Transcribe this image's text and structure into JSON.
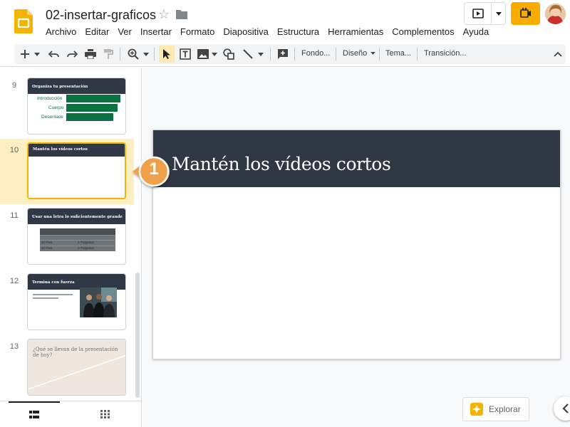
{
  "document": {
    "title": "02-insertar-graficos"
  },
  "menu": [
    "Archivo",
    "Editar",
    "Ver",
    "Insertar",
    "Formato",
    "Diapositiva",
    "Estructura",
    "Herramientas",
    "Complementos",
    "Ayuda"
  ],
  "toolbar": {
    "background": "Fondo...",
    "layout": "Diseño",
    "theme": "Tema...",
    "transition": "Transición..."
  },
  "filmstrip": {
    "slides": [
      {
        "number": "9",
        "title": "Organiza tu presentación",
        "rows": [
          "Introducción",
          "Cuerpo",
          "Desenlace"
        ]
      },
      {
        "number": "10",
        "title": "Mantén los vídeos cortos",
        "selected": true
      },
      {
        "number": "11",
        "title": "Usar una letra lo suficientemente grande",
        "table": [
          [
            "",
            ""
          ],
          [
            "30 Pies",
            "2 Pulgadas"
          ],
          [
            "30 Pies",
            "3 Pulgadas"
          ]
        ]
      },
      {
        "number": "12",
        "title": "Termina con fuerza"
      },
      {
        "number": "13",
        "title": "¿Qué se llevan de la presentación de hoy?"
      }
    ]
  },
  "slide": {
    "title": "Mantén los vídeos cortos"
  },
  "callout": {
    "number": "1"
  },
  "explore": {
    "label": "Explorar"
  },
  "colors": {
    "accent": "#f4b400",
    "slide_header": "#303745",
    "thumb_green": "#0b7042",
    "selected_row": "#feefc3",
    "callout": "#f0a04b"
  }
}
